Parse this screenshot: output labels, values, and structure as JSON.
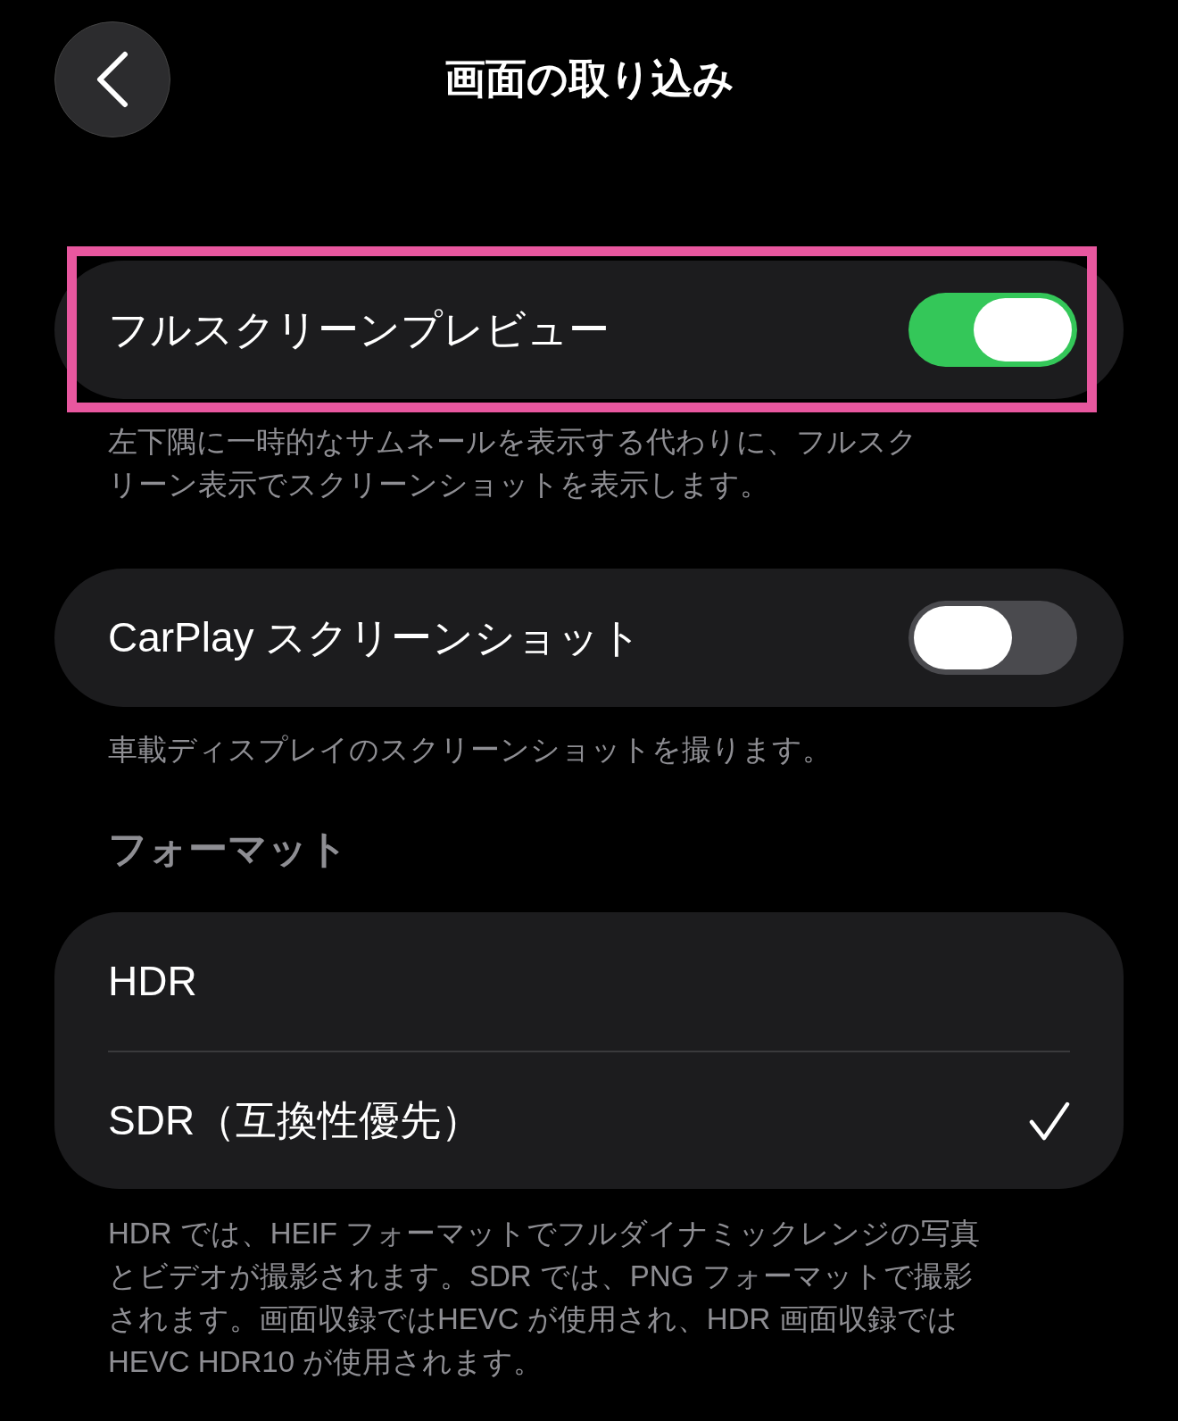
{
  "header": {
    "title": "画面の取り込み"
  },
  "toggles": [
    {
      "label": "フルスクリーンプレビュー",
      "on": true,
      "highlighted": true,
      "footnote": "左下隅に一時的なサムネールを表示する代わりに、フルスクリーン表示でスクリーンショットを表示します。"
    },
    {
      "label": "CarPlay スクリーンショット",
      "on": false,
      "highlighted": false,
      "footnote": "車載ディスプレイのスクリーンショットを撮ります。"
    }
  ],
  "format": {
    "header": "フォーマット",
    "options": [
      {
        "label": "HDR",
        "selected": false
      },
      {
        "label": "SDR（互換性優先）",
        "selected": true
      }
    ],
    "footnote": "HDR では、HEIF フォーマットでフルダイナミックレンジの写真とビデオが撮影されます。SDR では、PNG フォーマットで撮影されます。画面収録ではHEVC が使用され、HDR 画面収録ではHEVC HDR10 が使用されます。"
  }
}
